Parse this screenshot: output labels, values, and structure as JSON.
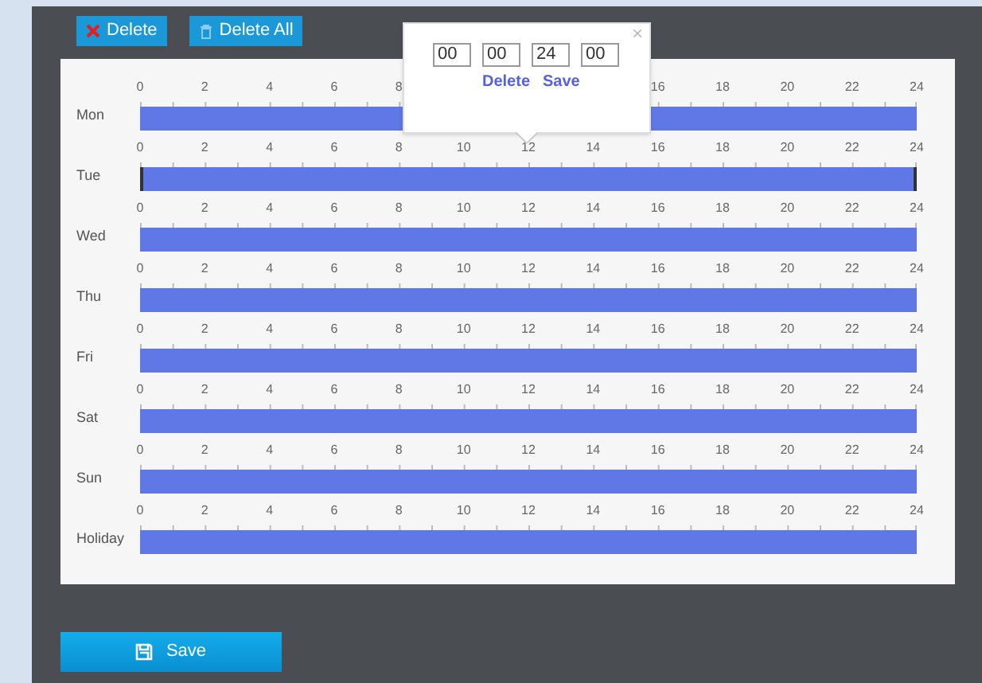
{
  "toolbar": {
    "delete_button": "Delete",
    "delete_all_button": "Delete All"
  },
  "days": [
    {
      "label": "Mon",
      "selected": false,
      "ticks": [
        "0",
        "2",
        "4",
        "6",
        "8",
        "16",
        "18",
        "20",
        "22",
        "24"
      ]
    },
    {
      "label": "Tue",
      "selected": true,
      "ticks": [
        "0",
        "2",
        "4",
        "6",
        "8",
        "10",
        "12",
        "14",
        "16",
        "18",
        "20",
        "22",
        "24"
      ]
    },
    {
      "label": "Wed",
      "selected": false,
      "ticks": [
        "0",
        "2",
        "4",
        "6",
        "8",
        "10",
        "12",
        "14",
        "16",
        "18",
        "20",
        "22",
        "24"
      ]
    },
    {
      "label": "Thu",
      "selected": false,
      "ticks": [
        "0",
        "2",
        "4",
        "6",
        "8",
        "10",
        "12",
        "14",
        "16",
        "18",
        "20",
        "22",
        "24"
      ]
    },
    {
      "label": "Fri",
      "selected": false,
      "ticks": [
        "0",
        "2",
        "4",
        "6",
        "8",
        "10",
        "12",
        "14",
        "16",
        "18",
        "20",
        "22",
        "24"
      ]
    },
    {
      "label": "Sat",
      "selected": false,
      "ticks": [
        "0",
        "2",
        "4",
        "6",
        "8",
        "10",
        "12",
        "14",
        "16",
        "18",
        "20",
        "22",
        "24"
      ]
    },
    {
      "label": "Sun",
      "selected": false,
      "ticks": [
        "0",
        "2",
        "4",
        "6",
        "8",
        "10",
        "12",
        "14",
        "16",
        "18",
        "20",
        "22",
        "24"
      ]
    },
    {
      "label": "Holiday",
      "selected": false,
      "ticks": [
        "0",
        "2",
        "4",
        "6",
        "8",
        "10",
        "12",
        "14",
        "16",
        "18",
        "20",
        "22",
        "24"
      ]
    }
  ],
  "popup": {
    "close": "×",
    "fields": [
      "00",
      "00",
      "24",
      "00"
    ],
    "delete_link": "Delete",
    "save_link": "Save"
  },
  "save_button": "Save"
}
